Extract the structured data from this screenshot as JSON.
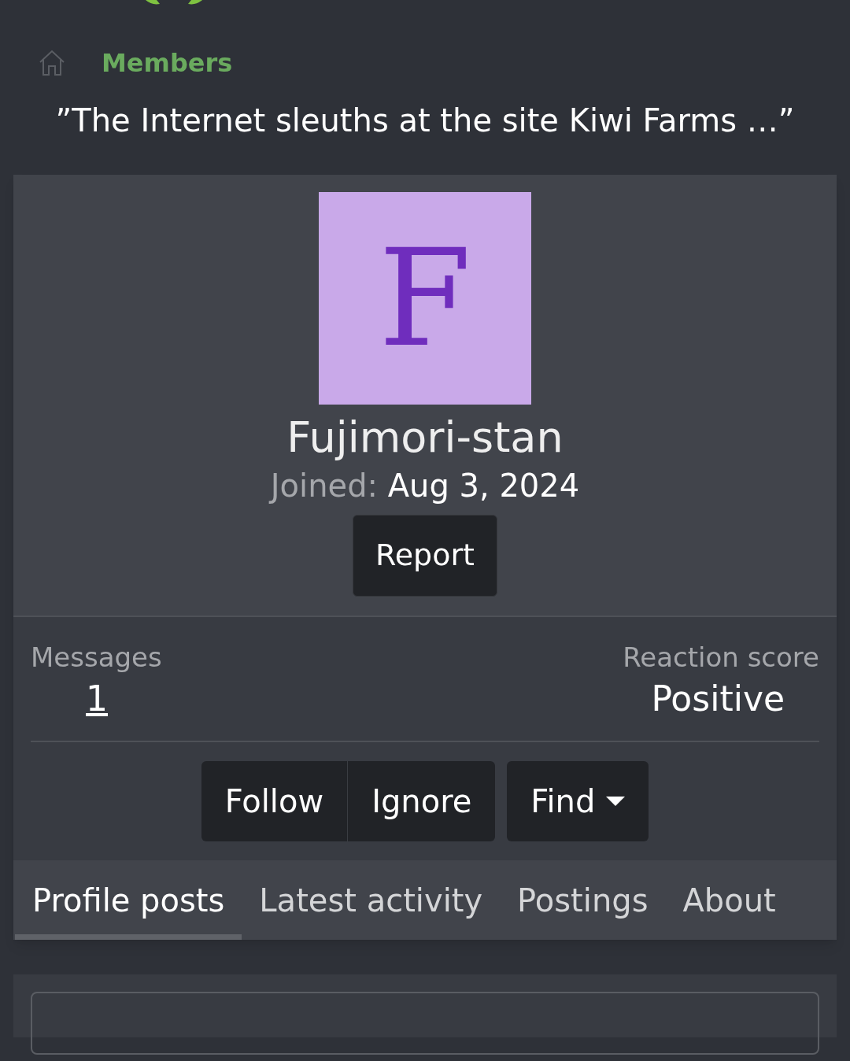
{
  "breadcrumb": {
    "label": "Members"
  },
  "quote": "”The Internet sleuths at the site Kiwi Farms …”",
  "profile": {
    "avatar_letter": "F",
    "username": "Fujimori-stan",
    "joined_label": "Joined:",
    "joined_date": "Aug 3, 2024",
    "report_button": "Report"
  },
  "stats": [
    {
      "label": "Messages",
      "value": "1",
      "kind": "link"
    },
    {
      "label": "Reaction score",
      "value": "Positive",
      "kind": "plain"
    }
  ],
  "actions": [
    {
      "label": "Follow",
      "kind": "group"
    },
    {
      "label": "Ignore",
      "kind": "group"
    },
    {
      "label": "Find",
      "kind": "dropdown"
    }
  ],
  "tabs": [
    {
      "label": "Profile posts",
      "selected": true
    },
    {
      "label": "Latest activity",
      "selected": false
    },
    {
      "label": "Postings",
      "selected": false
    },
    {
      "label": "About",
      "selected": false
    }
  ]
}
